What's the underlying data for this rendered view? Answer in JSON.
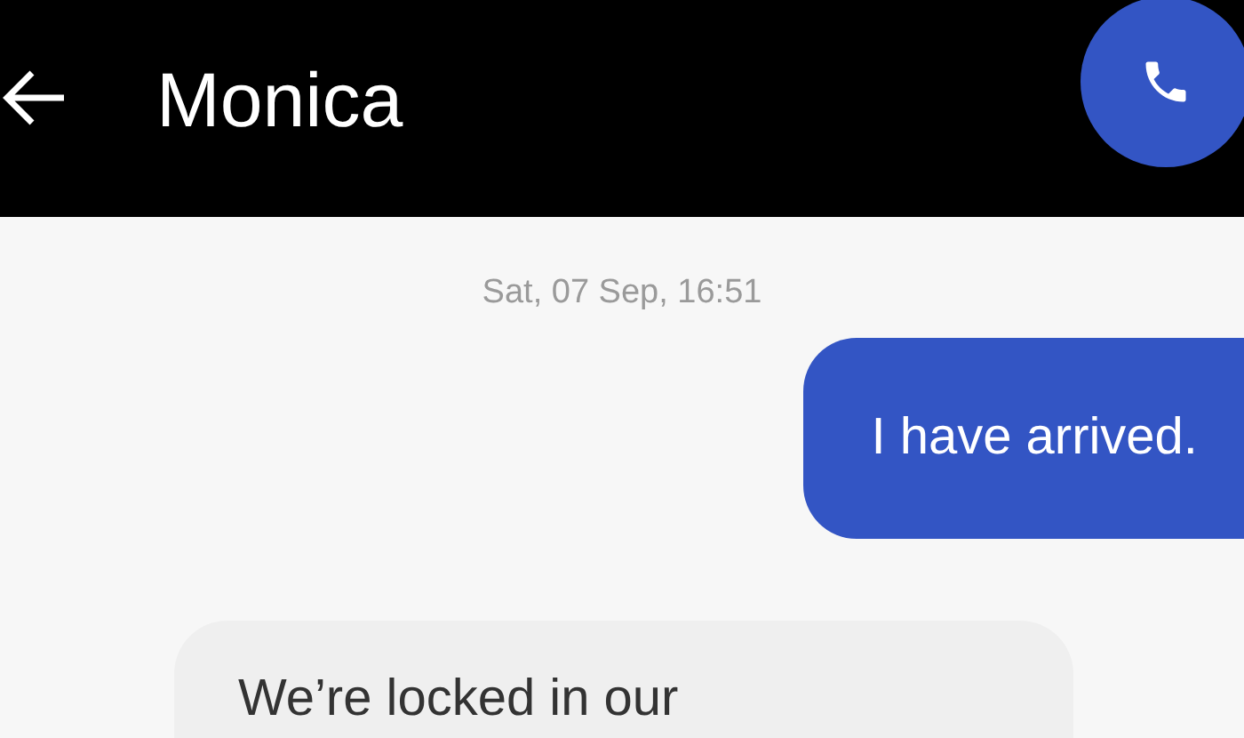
{
  "header": {
    "title": "Monica"
  },
  "messages": [
    {
      "kind": "timestamp",
      "text": "Sat, 07 Sep, 16:51"
    },
    {
      "kind": "sent",
      "text": "I have arrived."
    },
    {
      "kind": "received",
      "text": "We’re locked in our"
    }
  ]
}
